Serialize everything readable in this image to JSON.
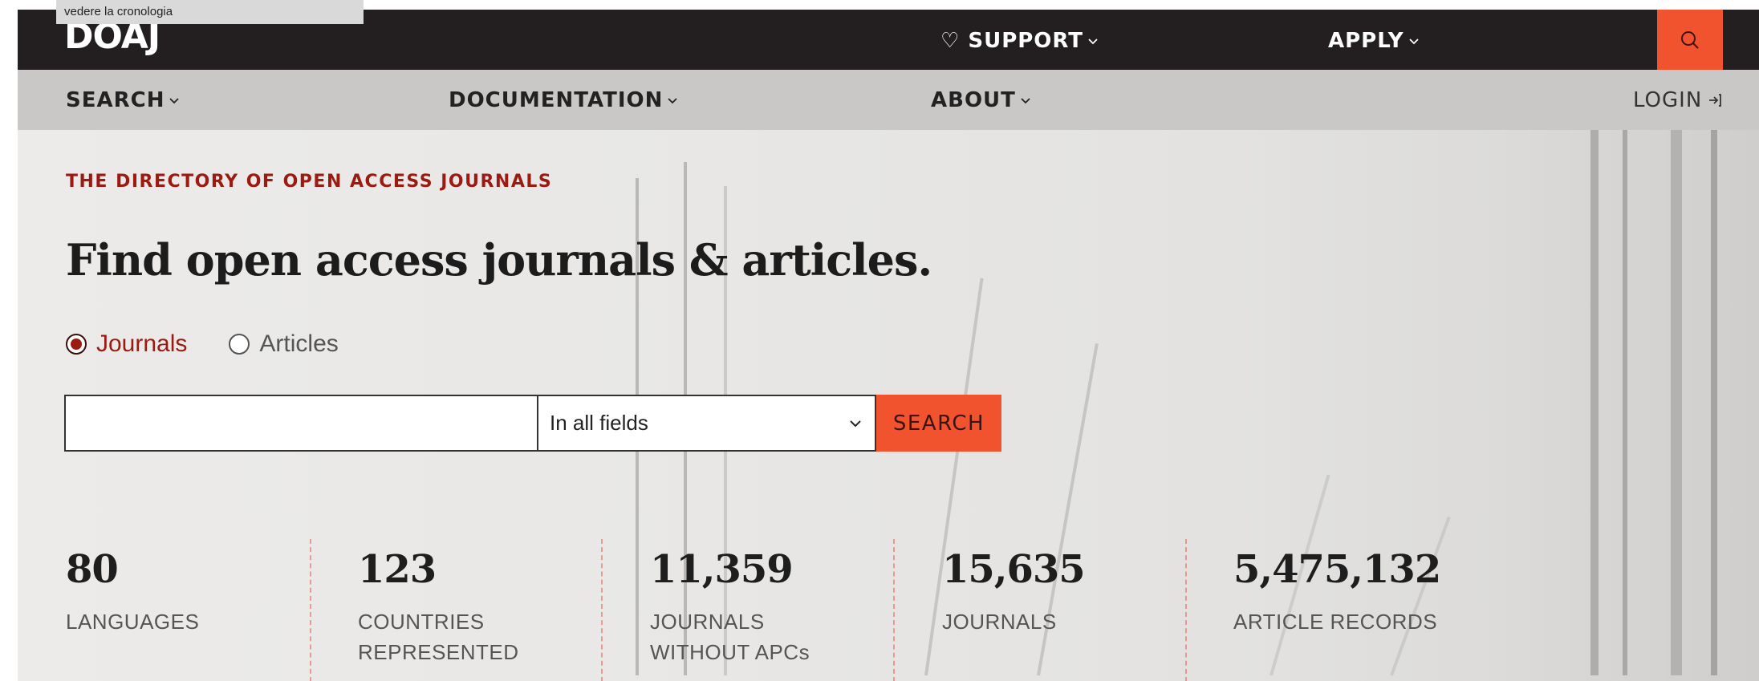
{
  "tooltip": "vedere la cronologia",
  "header": {
    "logo": "DOAJ",
    "support_label": "♡ SUPPORT",
    "apply_label": "APPLY"
  },
  "nav": {
    "search_label": "SEARCH",
    "documentation_label": "DOCUMENTATION",
    "about_label": "ABOUT",
    "login_label": "LOGIN"
  },
  "hero": {
    "kicker": "THE DIRECTORY OF OPEN ACCESS JOURNALS",
    "headline": "Find open access journals & articles.",
    "radio_journals": "Journals",
    "radio_articles": "Articles",
    "search_placeholder": "",
    "field_select": "In all fields",
    "search_button": "SEARCH"
  },
  "stats": [
    {
      "value": "80",
      "label1": "LANGUAGES",
      "label2": ""
    },
    {
      "value": "123",
      "label1": "COUNTRIES",
      "label2": "REPRESENTED"
    },
    {
      "value": "11,359",
      "label1": "JOURNALS",
      "label2": "WITHOUT APCs"
    },
    {
      "value": "15,635",
      "label1": "JOURNALS",
      "label2": ""
    },
    {
      "value": "5,475,132",
      "label1": "ARTICLE RECORDS",
      "label2": ""
    }
  ],
  "colors": {
    "accent": "#f2532f",
    "kicker": "#9b1a12",
    "topbar": "#231f20",
    "navbar": "#c9c8c6"
  }
}
